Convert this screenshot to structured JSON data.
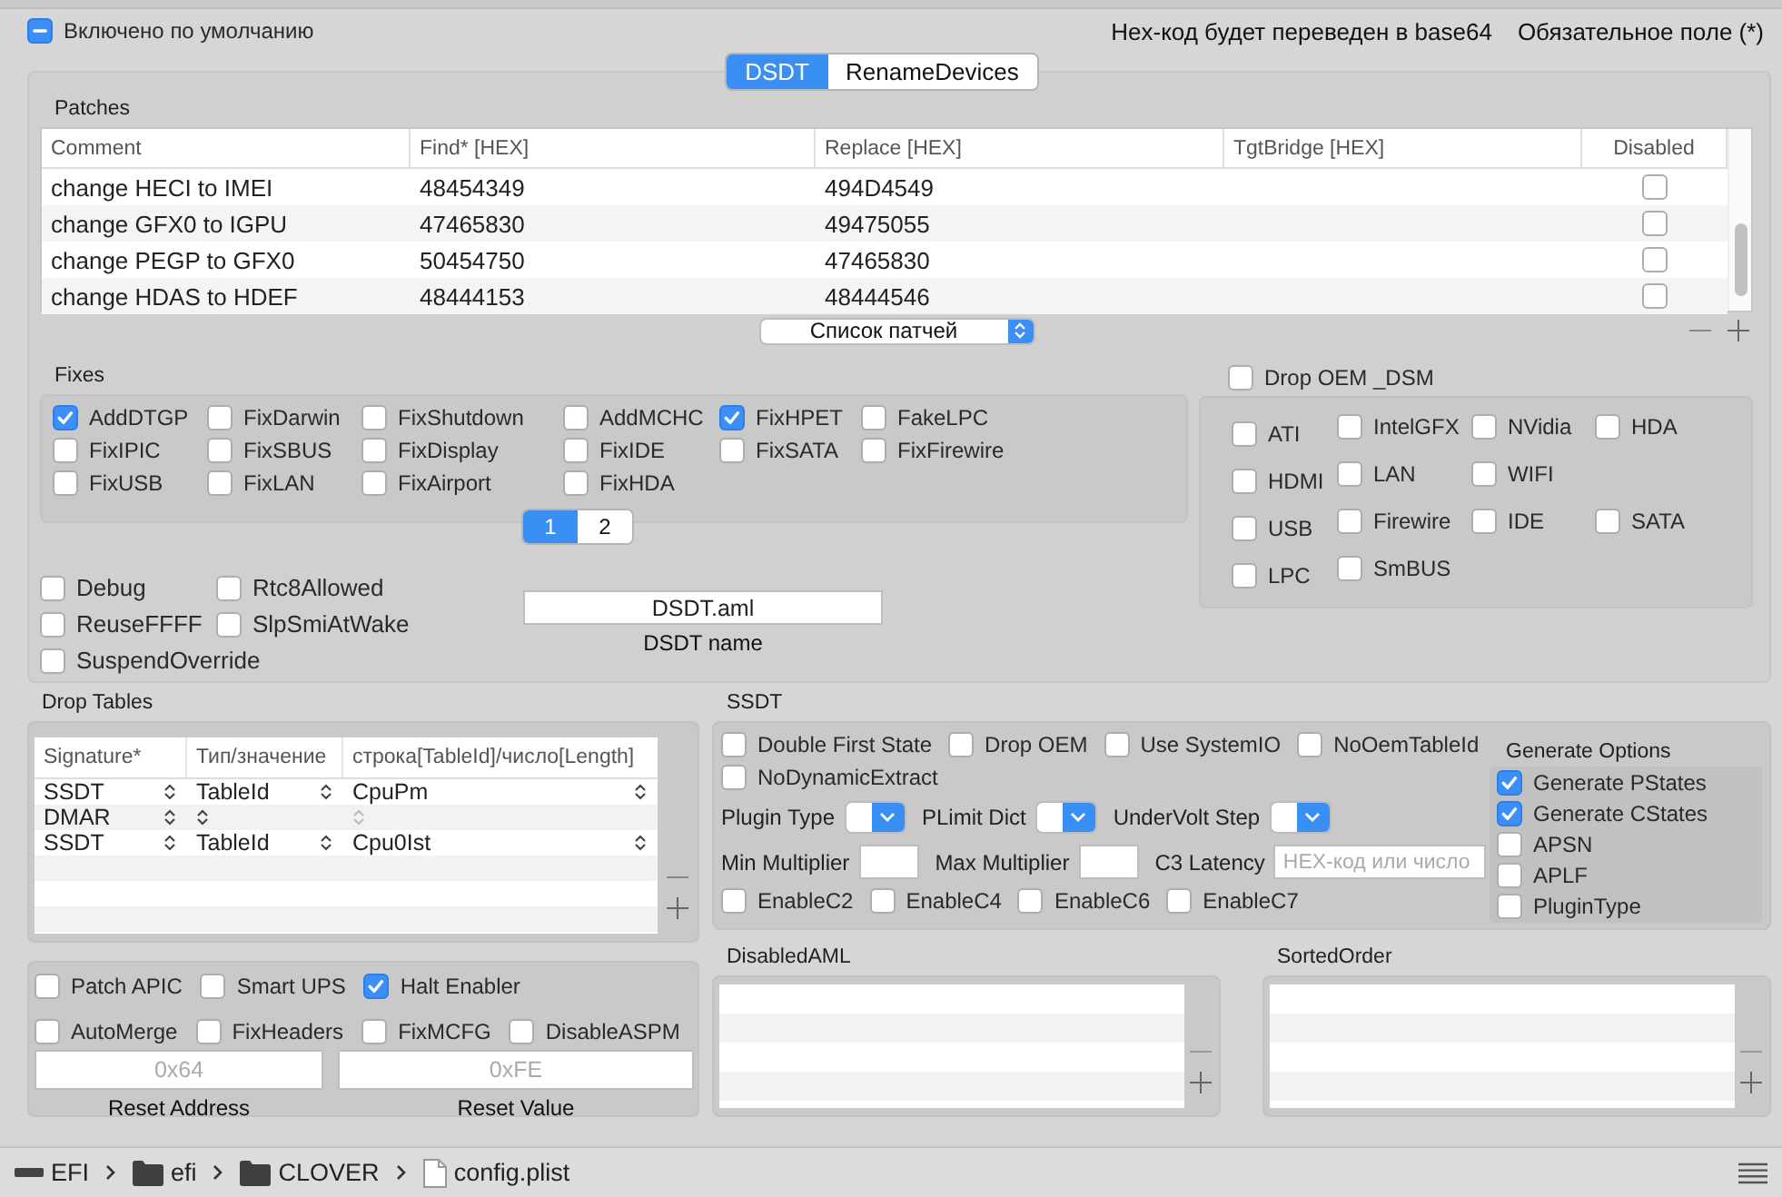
{
  "top": {
    "checkbox": {
      "label": "Включено по умолчанию",
      "mixed": true
    },
    "notes": [
      "Hex-код будет переведен в base64",
      "Обязательное поле (*)"
    ]
  },
  "tabs": [
    {
      "label": "DSDT",
      "selected": true
    },
    {
      "label": "RenameDevices",
      "selected": false
    }
  ],
  "patches": {
    "title": "Patches",
    "columns": [
      "Comment",
      "Find* [HEX]",
      "Replace [HEX]",
      "TgtBridge [HEX]",
      "Disabled"
    ],
    "rows": [
      {
        "comment": "change HECI to IMEI",
        "find": "48454349",
        "replace": "494D4549",
        "disabled": false
      },
      {
        "comment": "change GFX0 to IGPU",
        "find": "47465830",
        "replace": "49475055",
        "disabled": false
      },
      {
        "comment": "change PEGP to GFX0",
        "find": "50454750",
        "replace": "47465830",
        "disabled": false
      },
      {
        "comment": "change HDAS to HDEF",
        "find": "48444153",
        "replace": "48444546",
        "disabled": false
      }
    ],
    "popup": "Список патчей"
  },
  "fixes": {
    "title": "Fixes",
    "items": [
      {
        "label": "AddDTGP",
        "checked": true
      },
      {
        "label": "FixDarwin",
        "checked": false
      },
      {
        "label": "FixShutdown",
        "checked": false
      },
      {
        "label": "AddMCHC",
        "checked": false
      },
      {
        "label": "FixHPET",
        "checked": true
      },
      {
        "label": "FakeLPC",
        "checked": false
      },
      {
        "label": "FixIPIC",
        "checked": false
      },
      {
        "label": "FixSBUS",
        "checked": false
      },
      {
        "label": "FixDisplay",
        "checked": false
      },
      {
        "label": "FixIDE",
        "checked": false
      },
      {
        "label": "FixSATA",
        "checked": false
      },
      {
        "label": "FixFirewire",
        "checked": false
      },
      {
        "label": "FixUSB",
        "checked": false
      },
      {
        "label": "FixLAN",
        "checked": false
      },
      {
        "label": "FixAirport",
        "checked": false
      },
      {
        "label": "FixHDA",
        "checked": false
      }
    ],
    "pages": [
      {
        "label": "1",
        "selected": true
      },
      {
        "label": "2",
        "selected": false
      }
    ]
  },
  "options": [
    {
      "label": "Debug",
      "checked": false
    },
    {
      "label": "Rtc8Allowed",
      "checked": false
    },
    {
      "label": "ReuseFFFF",
      "checked": false
    },
    {
      "label": "SlpSmiAtWake",
      "checked": false
    },
    {
      "label": "SuspendOverride",
      "checked": false
    }
  ],
  "dsdt_name": {
    "value": "DSDT.aml",
    "label": "DSDT name"
  },
  "drop_oem_dsm": {
    "label": "Drop OEM _DSM",
    "checked": false,
    "rows": [
      [
        {
          "label": "ATI",
          "checked": false
        },
        {
          "label": "IntelGFX",
          "checked": false
        },
        {
          "label": "NVidia",
          "checked": false
        },
        {
          "label": "HDA",
          "checked": false
        }
      ],
      [
        {
          "label": "HDMI",
          "checked": false
        },
        {
          "label": "LAN",
          "checked": false
        },
        {
          "label": "WIFI",
          "checked": false
        }
      ],
      [
        {
          "label": "USB",
          "checked": false
        },
        {
          "label": "Firewire",
          "checked": false
        },
        {
          "label": "IDE",
          "checked": false
        },
        {
          "label": "SATA",
          "checked": false
        }
      ],
      [
        {
          "label": "LPC",
          "checked": false
        },
        {
          "label": "SmBUS",
          "checked": false
        }
      ]
    ]
  },
  "drop_tables": {
    "title": "Drop Tables",
    "columns": [
      "Signature*",
      "Тип/значение",
      "строка[TableId]/число[Length]"
    ],
    "rows": [
      {
        "signature": "SSDT",
        "type": "TableId",
        "value": "CpuPm"
      },
      {
        "signature": "DMAR"
      },
      {
        "signature": "SSDT",
        "type": "TableId",
        "value": "Cpu0Ist"
      }
    ]
  },
  "acpi": {
    "rows": [
      [
        {
          "label": "Patch APIC",
          "checked": false
        },
        {
          "label": "Smart UPS",
          "checked": false
        },
        {
          "label": "Halt Enabler",
          "checked": true
        }
      ],
      [
        {
          "label": "AutoMerge",
          "checked": false
        },
        {
          "label": "FixHeaders",
          "checked": false
        },
        {
          "label": "FixMCFG",
          "checked": false
        },
        {
          "label": "DisableASPM",
          "checked": false
        }
      ]
    ],
    "fields": [
      {
        "placeholder": "0x64",
        "label": "Reset Address"
      },
      {
        "placeholder": "0xFE",
        "label": "Reset Value"
      }
    ]
  },
  "ssdt": {
    "title": "SSDT",
    "check_rows": [
      [
        {
          "label": "Double First State",
          "checked": false
        },
        {
          "label": "Drop OEM",
          "checked": false
        },
        {
          "label": "Use SystemIO",
          "checked": false
        },
        {
          "label": "NoOemTableId",
          "checked": false
        }
      ],
      [
        {
          "label": "NoDynamicExtract",
          "checked": false
        }
      ]
    ],
    "popups": [
      "Plugin Type",
      "PLimit Dict",
      "UnderVolt Step"
    ],
    "fields": [
      {
        "label": "Min Multiplier"
      },
      {
        "label": "Max Multiplier"
      },
      {
        "label": "C3 Latency",
        "placeholder": "HEX-код или число"
      }
    ],
    "c_states": [
      {
        "label": "EnableC2",
        "checked": false
      },
      {
        "label": "EnableC4",
        "checked": false
      },
      {
        "label": "EnableC6",
        "checked": false
      },
      {
        "label": "EnableC7",
        "checked": false
      }
    ],
    "generate": {
      "title": "Generate Options",
      "items": [
        {
          "label": "Generate PStates",
          "checked": true
        },
        {
          "label": "Generate CStates",
          "checked": true
        },
        {
          "label": "APSN",
          "checked": false
        },
        {
          "label": "APLF",
          "checked": false
        },
        {
          "label": "PluginType",
          "checked": false
        }
      ]
    }
  },
  "lists": [
    {
      "title": "DisabledAML"
    },
    {
      "title": "SortedOrder"
    }
  ],
  "path": [
    {
      "label": "EFI",
      "kind": "drive"
    },
    {
      "label": "efi",
      "kind": "folder"
    },
    {
      "label": "CLOVER",
      "kind": "folder"
    },
    {
      "label": "config.plist",
      "kind": "file"
    }
  ]
}
